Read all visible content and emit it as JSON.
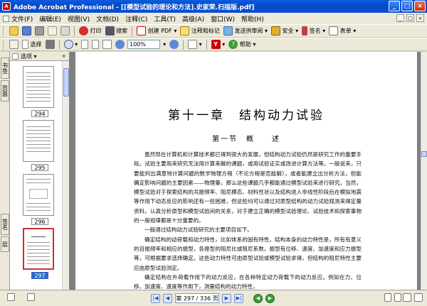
{
  "window": {
    "title": "Adobe Acrobat Professional - [[模型试验的理论和方法].史家荣.扫描版.pdf]",
    "app_icon_label": "A",
    "minimize": "_",
    "maximize": "□",
    "close": "×"
  },
  "menu": [
    "文件(F)",
    "编辑(E)",
    "视图(V)",
    "文档(D)",
    "注释(C)",
    "工具(T)",
    "高级(A)",
    "窗口(W)",
    "帮助(H)"
  ],
  "menu_ctrls": [
    "_",
    "□",
    "×"
  ],
  "toolbar1": {
    "create_pdf": "创建 PDF",
    "comment": "注释和标记",
    "send_review": "发送供审阅",
    "secure": "安全",
    "sign": "签名",
    "forms": "表单",
    "print_label": "打印",
    "search_label": "搜索"
  },
  "toolbar2": {
    "select": "选择",
    "zoom": "100%",
    "help": "帮助"
  },
  "leftpanel": {
    "tabs": [
      "书签",
      "页面",
      "签名",
      "层"
    ],
    "header": "选项",
    "close": "×",
    "thumbs": [
      {
        "label": "294"
      },
      {
        "label": "295"
      },
      {
        "label": "296"
      },
      {
        "label": "297",
        "selected": true
      }
    ]
  },
  "page": {
    "chapter": "第十一章　结构动力试验",
    "section": "第一节　概　　述",
    "paragraphs": [
      "虽然现在计算机和计算技术都已得到很大的发展，但结构动力试验仍然是研究工作的重要手段。试验主要用来研究无法用计算来解的课题，或用试验证实或改进计算方法等。一般说来，只要能列出满意地计算问题的数学物理方程（不论方程是否能解），或者能建立出分析方法，但能确定影响问题的主要因素——物理量，那么这些课题几乎都能通过模型试验来进行研究。当然，模型试验对于探索结构的共振频率、阻尼模态、材料性状以及结构进入非线性阶段后在模拟地震等作用下动态反应的影响还有一些困难，但这些均可以通过对原型结构的动力试验观测来得定量资料。认真分析原型和模型试验间的关系，对于建立正确的模型试验理论、试验技术和探索事物的一般规律都是十分重要的。",
      "一般通过结构动力试验研究的主要项目如下。",
      "确定结构的动荷载和动力特性，比如体系的固有特性。结构本身的动力特性是，所有有意义的自振频率和相应的振型，各振型的阻尼比或阻尼系数。振型有位移、速度、加速度和应力振型等，可根据要求选择确定。这些动力特性可由原型试验或模型试验求得，但结构的阻尼特性主要应由原型试验测定。",
      "确定结构在外荷载作用下的动力反应，在各种特定动力荷载下的动力反应。例如在力、位移、加速度、速度等作用下，测量结构的动力特性，"
    ]
  },
  "status": {
    "page_text": "第 297 / 336 页"
  }
}
